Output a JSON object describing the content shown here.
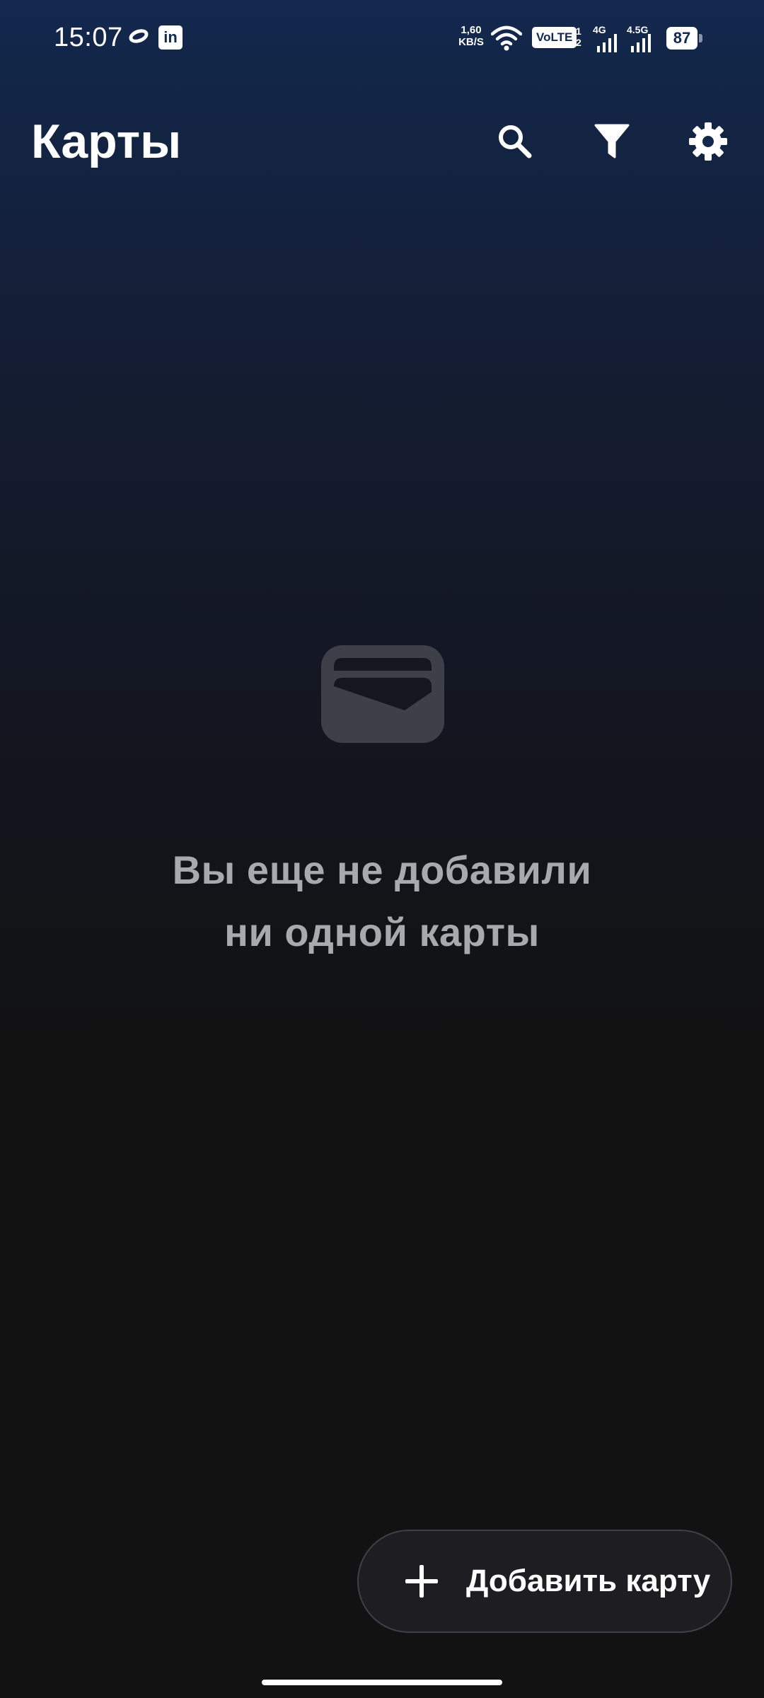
{
  "status_bar": {
    "time": "15:07",
    "notification_icons": [
      "ring-icon",
      "linkedin-icon"
    ],
    "linkedin_glyph": "in",
    "net_speed_value": "1,60",
    "net_speed_unit": "KB/S",
    "volte": "VoLTE",
    "sim1": "1",
    "sim2": "2",
    "signal_1_label": "4G",
    "signal_2_label": "4.5G",
    "battery": "87"
  },
  "app_bar": {
    "title": "Карты",
    "actions": [
      "search-icon",
      "filter-icon",
      "gear-icon"
    ]
  },
  "empty_state": {
    "icon": "wallet-icon",
    "line1": "Вы еще не добавили",
    "line2": "ни одной карты"
  },
  "fab": {
    "icon": "plus-icon",
    "label": "Добавить карту"
  },
  "colors": {
    "background_top": "#12284d",
    "background_bottom": "#121212",
    "empty_text": "#a7a9ae",
    "fab_background": "#1e1e22"
  }
}
